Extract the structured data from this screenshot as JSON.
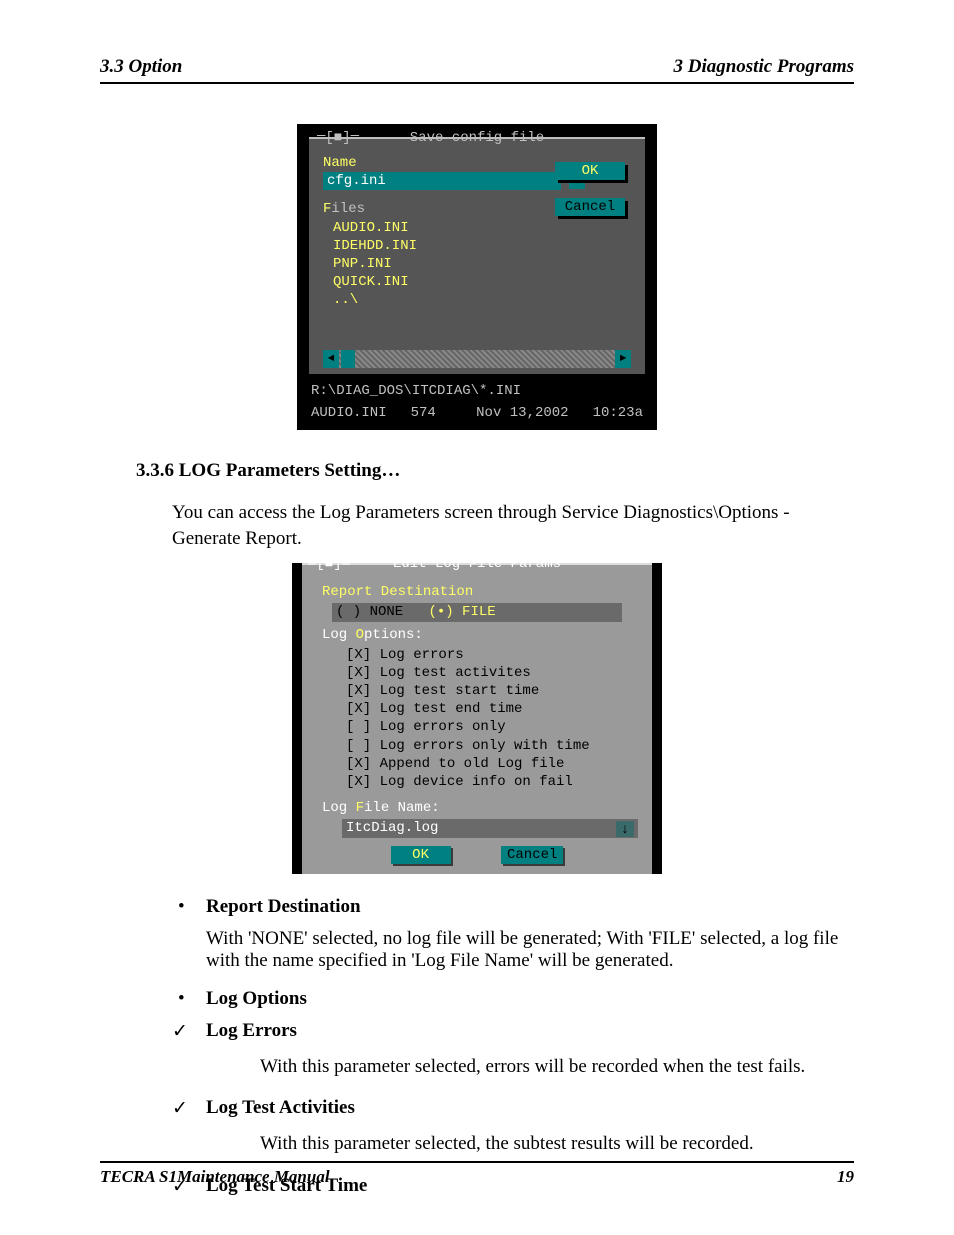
{
  "header": {
    "left": "3.3 Option",
    "right": "3  Diagnostic Programs"
  },
  "footer": {
    "left": "TECRA S1Maintenance Manual",
    "right": "19"
  },
  "dialog1": {
    "title": "Save config file",
    "close_glyph": "═[■]═",
    "name_label": "Name",
    "name_value": "cfg.ini",
    "history_glyph": "↓",
    "ok_label": "OK",
    "cancel_label": "Cancel",
    "files_label_hotkey": "F",
    "files_label_rest": "iles",
    "files": [
      "AUDIO.INI",
      "IDEHDD.INI",
      "PNP.INI",
      "QUICK.INI",
      "..\\"
    ],
    "path": "R:\\DIAG_DOS\\ITCDIAG\\*.INI",
    "status_file": "AUDIO.INI",
    "status_size": "574",
    "status_date": "Nov 13,2002",
    "status_time": "10:23a"
  },
  "section_heading": "3.3.6   LOG Parameters Setting…",
  "section_para": "You can access the Log Parameters screen through Service Diagnostics\\Options - Generate Report.",
  "dialog2": {
    "title": "Edit Log File Params",
    "close_glyph": "═[■]═",
    "dest_label": "Report Destination",
    "radio_none": "( ) NONE",
    "radio_file": "(•) FILE",
    "logopts_hot": "O",
    "logopts_pre": "Log ",
    "logopts_post": "ptions:",
    "options": [
      {
        "checked": true,
        "label": "Log errors"
      },
      {
        "checked": true,
        "label": "Log test activites"
      },
      {
        "checked": true,
        "label": "Log test start time"
      },
      {
        "checked": true,
        "label": "Log test end time"
      },
      {
        "checked": false,
        "label": "Log errors only"
      },
      {
        "checked": false,
        "label": "Log errors only with time"
      },
      {
        "checked": true,
        "label": "Append to old Log file"
      },
      {
        "checked": true,
        "label": "Log device info on fail"
      }
    ],
    "file_label_pre": "Log ",
    "file_label_hot": "F",
    "file_label_post": "ile Name:",
    "file_value": "ItcDiag.log",
    "history_glyph": "↓",
    "ok_label": "OK",
    "cancel_label": "Cancel"
  },
  "list": {
    "report_dest_title": "Report Destination",
    "report_dest_desc": "With 'NONE' selected, no log file will be generated; With 'FILE' selected, a log file with the name specified in 'Log File Name' will be generated.",
    "log_options_title": "Log Options",
    "log_errors_title": "Log Errors",
    "log_errors_desc": "With this parameter selected, errors will be recorded when the test fails.",
    "log_activities_title": "Log Test Activities",
    "log_activities_desc": "With this parameter selected, the subtest results will be recorded.",
    "log_start_title": "Log Test Start Time"
  }
}
